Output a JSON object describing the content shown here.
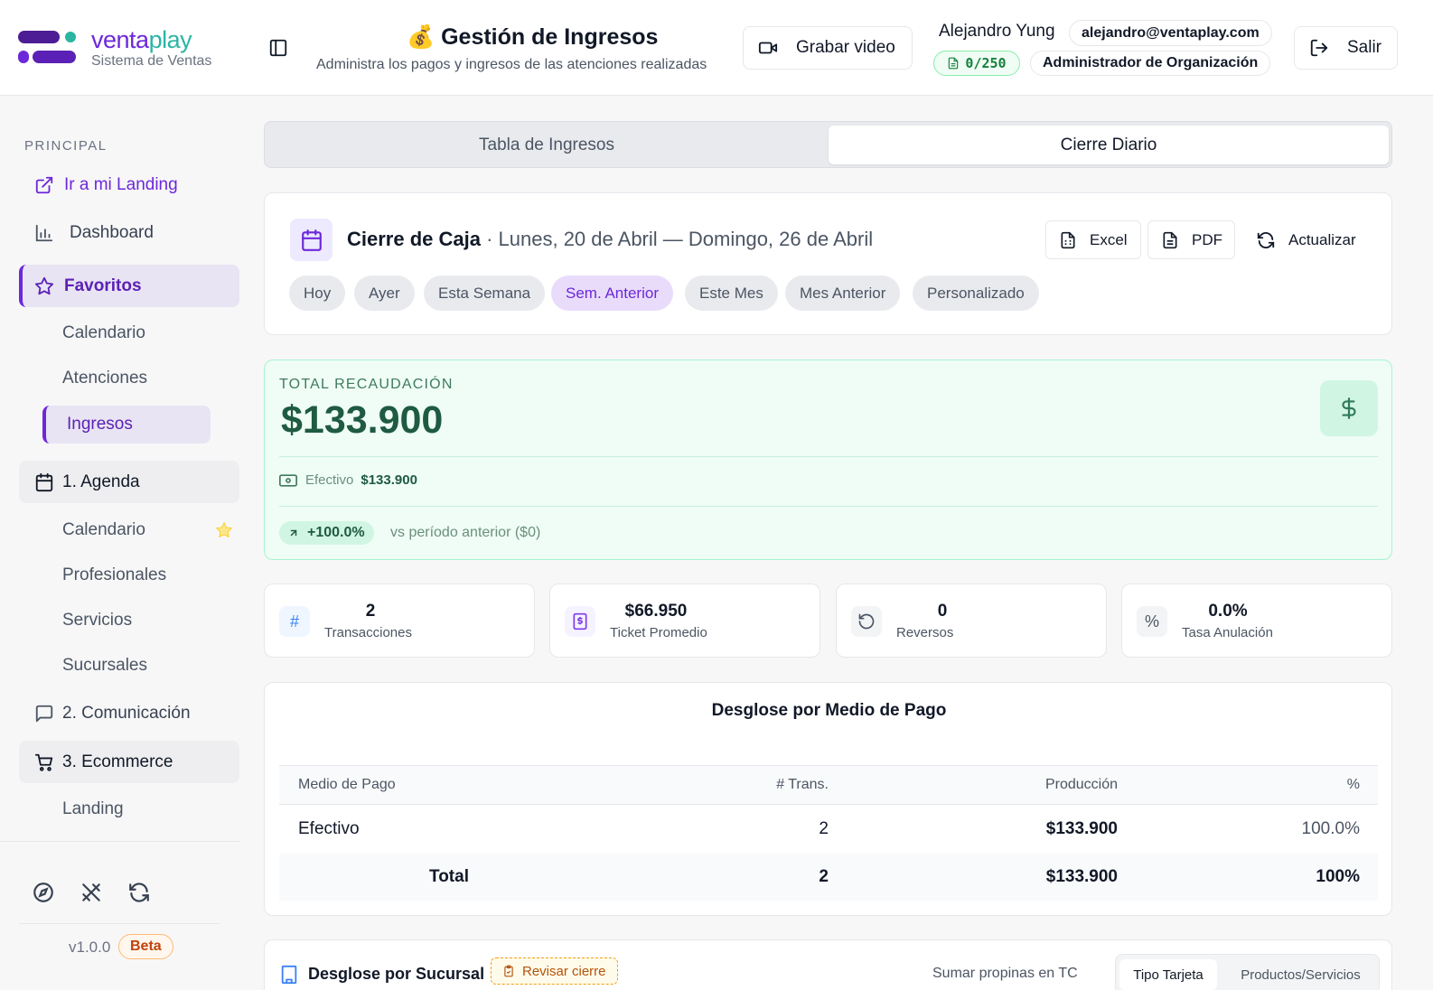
{
  "brand": {
    "name_part1": "venta",
    "name_part2": "play",
    "subtitle": "Sistema de Ventas"
  },
  "sidebar": {
    "section_label": "PRINCIPAL",
    "landing": "Ir a mi Landing",
    "dashboard": "Dashboard",
    "favoritos": {
      "label": "Favoritos",
      "items": [
        "Calendario",
        "Atenciones",
        "Ingresos"
      ]
    },
    "agenda": {
      "label": "1. Agenda",
      "items": [
        "Calendario",
        "Profesionales",
        "Servicios",
        "Sucursales"
      ]
    },
    "comunicacion": "2. Comunicación",
    "ecommerce": {
      "label": "3. Ecommerce",
      "items": [
        "Landing"
      ]
    },
    "version": "v1.0.0",
    "beta": "Beta"
  },
  "header": {
    "title_emoji": "💰",
    "title": "Gestión de Ingresos",
    "subtitle": "Administra los pagos y ingresos de las atenciones realizadas",
    "record_button": "Grabar video",
    "user_name": "Alejandro Yung",
    "user_email": "alejandro@ventaplay.com",
    "quota": "0/250",
    "role": "Administrador de Organización",
    "logout": "Salir"
  },
  "tabs": [
    "Tabla de Ingresos",
    "Cierre Diario"
  ],
  "cierre": {
    "title": "Cierre de Caja",
    "separator": " · ",
    "range": "Lunes, 20 de Abril — Domingo, 26 de Abril",
    "buttons": {
      "excel": "Excel",
      "pdf": "PDF",
      "refresh": "Actualizar"
    },
    "filters": [
      "Hoy",
      "Ayer",
      "Esta Semana",
      "Sem. Anterior",
      "Este Mes",
      "Mes Anterior",
      "Personalizado"
    ],
    "selected_filter": "Sem. Anterior"
  },
  "total": {
    "label": "TOTAL RECAUDACIÓN",
    "value": "$133.900",
    "cash_label": "Efectivo",
    "cash_value": "$133.900",
    "change": "+100.0%",
    "vs_text": "vs período anterior ($0)"
  },
  "stats": [
    {
      "value": "2",
      "label": "Transacciones",
      "icon": "hash-icon"
    },
    {
      "value": "$66.950",
      "label": "Ticket Promedio",
      "icon": "receipt-icon"
    },
    {
      "value": "0",
      "label": "Reversos",
      "icon": "undo-icon"
    },
    {
      "value": "0.0%",
      "label": "Tasa Anulación",
      "icon": "percent-icon"
    }
  ],
  "breakdown": {
    "title": "Desglose por Medio de Pago",
    "columns": [
      "Medio de Pago",
      "# Trans.",
      "Producción",
      "%"
    ],
    "rows": [
      {
        "medio": "Efectivo",
        "trans": "2",
        "produccion": "$133.900",
        "pct": "100.0%"
      }
    ],
    "total": {
      "label": "Total",
      "trans": "2",
      "produccion": "$133.900",
      "pct": "100%"
    }
  },
  "sucursal": {
    "title": "Desglose por Sucursal",
    "review": "Revisar cierre",
    "tips": "Sumar propinas en TC",
    "segments": [
      "Tipo Tarjeta",
      "Productos/Servicios"
    ]
  },
  "colors": {
    "brand_purple": "#6d28d9",
    "brand_teal": "#2bb5a3",
    "success_green": "#1f5a43",
    "active_bg": "#e8e4f3"
  }
}
